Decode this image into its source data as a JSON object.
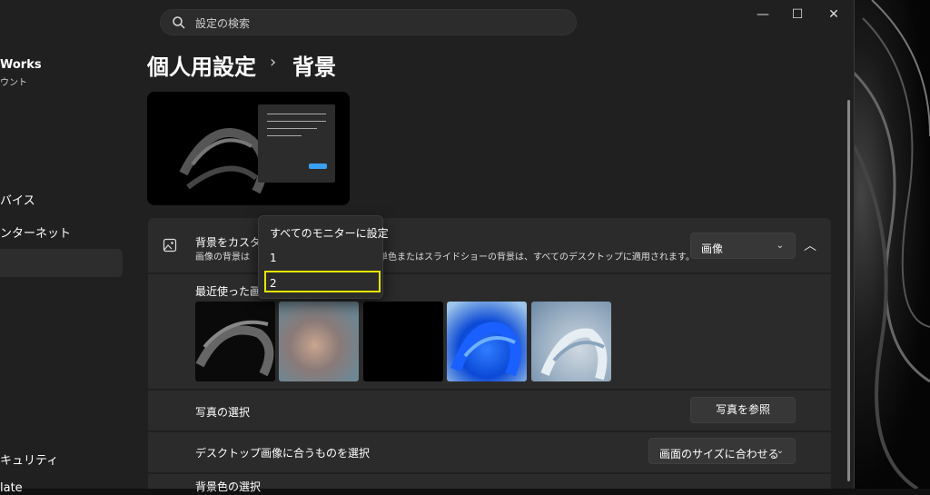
{
  "search": {
    "placeholder": "設定の検索"
  },
  "sidebar": {
    "account_name": "Works",
    "account_sub": "ウント",
    "items": [
      {
        "label": "バイス"
      },
      {
        "label": "ンターネット"
      },
      {
        "label": "キュリティ"
      },
      {
        "label": "late"
      }
    ]
  },
  "window_controls": {
    "minimize": "—",
    "maximize": "☐",
    "close": "✕"
  },
  "breadcrumb": {
    "parent": "個人用設定",
    "current": "背景",
    "separator": "›"
  },
  "background_section": {
    "title": "背景をカスタマ",
    "description_left": "画像の背景は",
    "description_right": "単色またはスライドショーの背景は、すべてのデスクトップに適用されます。",
    "type_value": "画像",
    "collapse_glyph": "︿"
  },
  "recent_images": {
    "label": "最近使った画"
  },
  "photo_choose": {
    "label": "写真の選択",
    "button": "写真を参照"
  },
  "fit_choose": {
    "label": "デスクトップ画像に合うものを選択",
    "value": "画面のサイズに合わせる"
  },
  "bg_color": {
    "label": "背景色の選択"
  },
  "monitor_menu": {
    "options": [
      "すべてのモニターに設定",
      "1",
      "2"
    ],
    "focused_index": 2
  },
  "icons": {
    "search": "search-icon",
    "image": "image-icon",
    "chevron": "chevron-down-icon"
  }
}
